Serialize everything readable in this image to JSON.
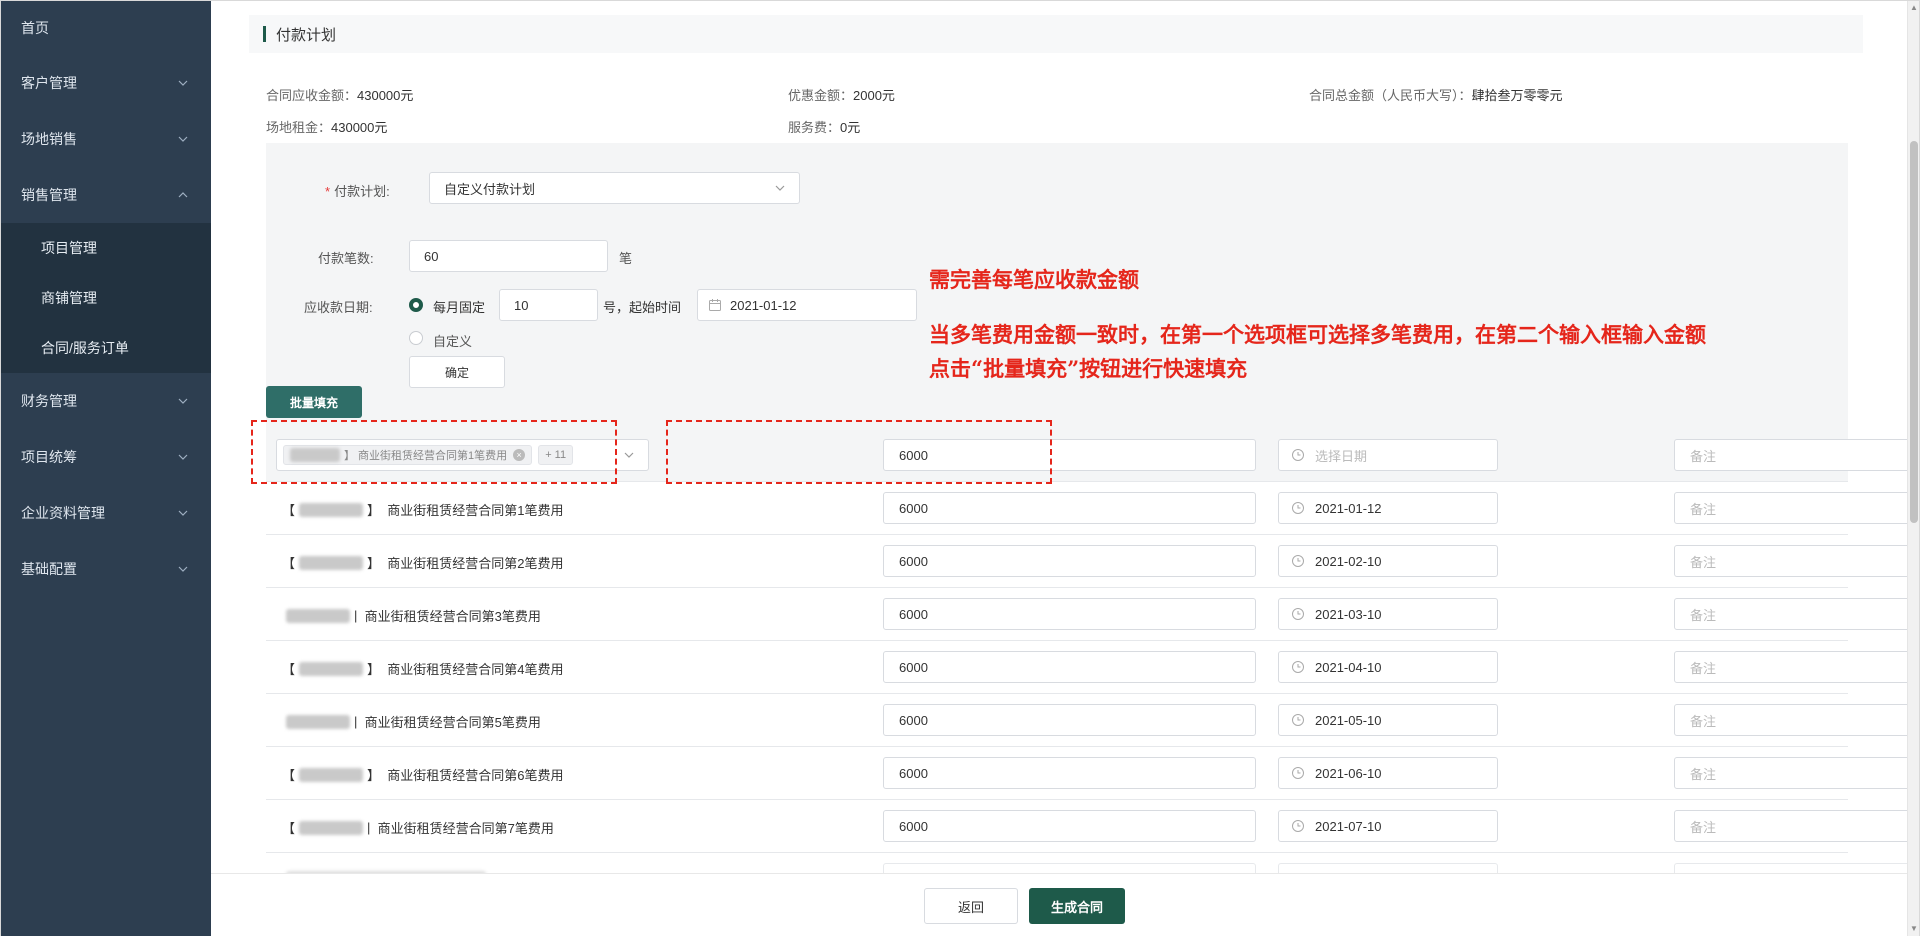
{
  "sidebar": {
    "items": [
      {
        "label": "首页"
      },
      {
        "label": "客户管理"
      },
      {
        "label": "场地销售"
      },
      {
        "label": "销售管理"
      },
      {
        "label": "财务管理"
      },
      {
        "label": "项目统筹"
      },
      {
        "label": "企业资料管理"
      },
      {
        "label": "基础配置"
      }
    ],
    "sales_sub": [
      {
        "label": "项目管理"
      },
      {
        "label": "商铺管理"
      },
      {
        "label": "合同/服务订单"
      }
    ]
  },
  "section": {
    "title": "付款计划"
  },
  "summary": {
    "receivable_label": "合同应收金额：",
    "receivable_value": "430000元",
    "discount_label": "优惠金额：",
    "discount_value": "2000元",
    "total_cn_label": "合同总金额（人民币大写）：",
    "total_cn_value": "肆拾叁万零零元",
    "rent_label": "场地租金：",
    "rent_value": "430000元",
    "service_label": "服务费：",
    "service_value": "0元"
  },
  "form": {
    "plan_label": "付款计划:",
    "plan_value": "自定义付款计划",
    "count_label": "付款笔数:",
    "count_value": "60",
    "count_unit": "笔",
    "date_label": "应收款日期:",
    "radio_fixed": "每月固定",
    "day_value": "10",
    "day_suffix": "号，起始时间",
    "start_date": "2021-01-12",
    "radio_custom": "自定义",
    "confirm": "确定",
    "batch_fill": "批量填充"
  },
  "annotations": {
    "line1": "需完善每笔应收款金额",
    "line2": "当多笔费用金额一致时，在第一个选项框可选择多笔费用，在第二个输入框输入金额",
    "line3": "点击“批量填充”按钮进行快速填充"
  },
  "batch_row": {
    "tag_text": "】 商业街租赁经营合同第1笔费用",
    "more": "+ 11",
    "amount": "6000",
    "date_placeholder": "选择日期",
    "remark_placeholder": "备注"
  },
  "rows": [
    {
      "left": "【",
      "right": "】",
      "name": "商业街租赁经营合同第1笔费用",
      "amount": "6000",
      "date": "2021-01-12",
      "remark": "备注"
    },
    {
      "left": "【",
      "right": "】",
      "name": "商业街租赁经营合同第2笔费用",
      "amount": "6000",
      "date": "2021-02-10",
      "remark": "备注"
    },
    {
      "left": "",
      "right": "|",
      "name": "商业街租赁经营合同第3笔费用",
      "amount": "6000",
      "date": "2021-03-10",
      "remark": "备注"
    },
    {
      "left": "【",
      "right": "】",
      "name": "商业街租赁经营合同第4笔费用",
      "amount": "6000",
      "date": "2021-04-10",
      "remark": "备注"
    },
    {
      "left": "",
      "right": "|",
      "name": "商业街租赁经营合同第5笔费用",
      "amount": "6000",
      "date": "2021-05-10",
      "remark": "备注"
    },
    {
      "left": "【",
      "right": "】",
      "name": "商业街租赁经营合同第6笔费用",
      "amount": "6000",
      "date": "2021-06-10",
      "remark": "备注"
    },
    {
      "left": "【",
      "right": "|",
      "name": "商业街租赁经营合同第7笔费用",
      "amount": "6000",
      "date": "2021-07-10",
      "remark": "备注"
    }
  ],
  "footer": {
    "back": "返回",
    "generate": "生成合同"
  },
  "colors": {
    "sidebar_bg": "#2d3e50",
    "accent": "#1e5a4a",
    "annotation": "#e5261b"
  }
}
